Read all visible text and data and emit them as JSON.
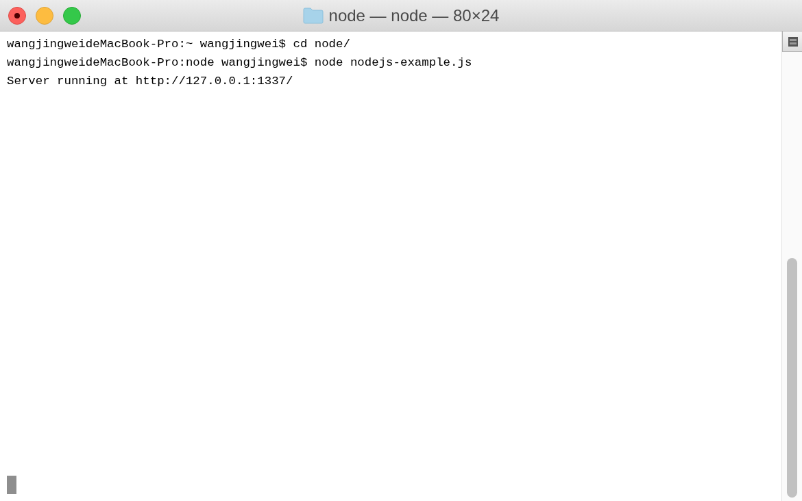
{
  "window": {
    "title": "node — node — 80×24"
  },
  "lines": [
    "wangjingweideMacBook-Pro:~ wangjingwei$ cd node/",
    "wangjingweideMacBook-Pro:node wangjingwei$ node nodejs-example.js",
    "Server running at http://127.0.0.1:1337/"
  ]
}
